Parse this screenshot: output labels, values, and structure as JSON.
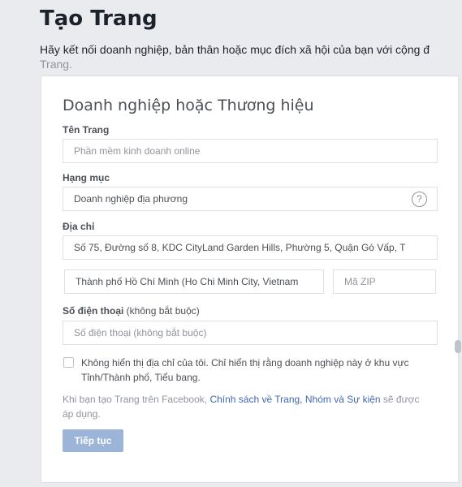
{
  "header": {
    "title": "Tạo Trang",
    "description": "Hãy kết nối doanh nghiệp, bản thân hoặc mục đích xã hội của bạn với cộng đ",
    "description_cont": "Trang."
  },
  "form": {
    "title": "Doanh nghiệp hoặc Thương hiệu",
    "page_name": {
      "label": "Tên Trang",
      "placeholder": "Phần mềm kinh doanh online"
    },
    "category": {
      "label": "Hạng mục",
      "value": "Doanh nghiệp địa phương",
      "help_icon": "?"
    },
    "address": {
      "label": "Địa chỉ",
      "street": "Số 75, Đường số 8, KDC CityLand Garden Hills, Phường 5, Quận Gò Vấp, T",
      "city": "Thành phố Hồ Chí Minh (Ho Chi Minh City, Vietnam",
      "zip_placeholder": "Mã ZIP"
    },
    "phone": {
      "label": "Số điện thoại",
      "label_optional": " (không bắt buộc)",
      "placeholder": "Số điện thoại (không bắt buộc)"
    },
    "hide_address": {
      "checked": false,
      "label": "Không hiển thị địa chỉ của tôi. Chỉ hiển thị rằng doanh nghiệp này ở khu vực Tỉnh/Thành phố, Tiểu bang."
    },
    "policy": {
      "prefix": "Khi bạn tạo Trang trên Facebook, ",
      "link": "Chính sách về Trang, Nhóm và Sự kiện",
      "suffix": " sẽ được áp dụng."
    },
    "continue_label": "Tiếp tục"
  },
  "colors": {
    "background": "#e9ebee",
    "link": "#4267b2",
    "button_disabled": "#9cb4d8"
  }
}
